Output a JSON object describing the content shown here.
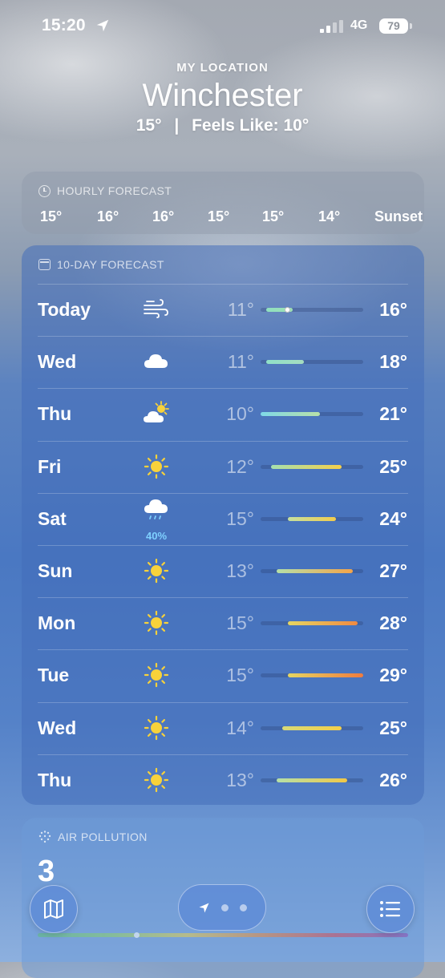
{
  "status_bar": {
    "time": "15:20",
    "network": "4G",
    "battery": "79"
  },
  "header": {
    "label": "MY LOCATION",
    "city": "Winchester",
    "current_temp": "15°",
    "separator": "|",
    "feels_like": "Feels Like: 10°"
  },
  "hourly": {
    "title": "HOURLY FORECAST",
    "items": [
      "15°",
      "16°",
      "16°",
      "15°",
      "15°",
      "14°",
      "Sunset"
    ]
  },
  "ten_day": {
    "title": "10-DAY FORECAST",
    "range_min": 10,
    "range_max": 29,
    "current_temp_value": 15,
    "rows": [
      {
        "day": "Today",
        "icon": "wind-icon",
        "low": "11°",
        "high": "16°",
        "low_value": 11,
        "high_value": 16,
        "precip": "",
        "colors": [
          "#8fe0c0",
          "#9ee0b4"
        ]
      },
      {
        "day": "Wed",
        "icon": "cloud-icon",
        "low": "11°",
        "high": "18°",
        "low_value": 11,
        "high_value": 18,
        "precip": "",
        "colors": [
          "#8fe0c8",
          "#a5dcc0"
        ]
      },
      {
        "day": "Thu",
        "icon": "partly-sunny-icon",
        "low": "10°",
        "high": "21°",
        "low_value": 10,
        "high_value": 21,
        "precip": "",
        "colors": [
          "#7fd9e8",
          "#b8e0a8"
        ]
      },
      {
        "day": "Fri",
        "icon": "sun-icon",
        "low": "12°",
        "high": "25°",
        "low_value": 12,
        "high_value": 25,
        "precip": "",
        "colors": [
          "#a5e0b0",
          "#f5cf4a"
        ]
      },
      {
        "day": "Sat",
        "icon": "rain-icon",
        "low": "15°",
        "high": "24°",
        "low_value": 15,
        "high_value": 24,
        "precip": "40%",
        "colors": [
          "#c5e0a0",
          "#f2cc4c"
        ]
      },
      {
        "day": "Sun",
        "icon": "sun-icon",
        "low": "13°",
        "high": "27°",
        "low_value": 13,
        "high_value": 27,
        "precip": "",
        "colors": [
          "#b5e0a8",
          "#f4a44a"
        ]
      },
      {
        "day": "Mon",
        "icon": "sun-icon",
        "low": "15°",
        "high": "28°",
        "low_value": 15,
        "high_value": 28,
        "precip": "",
        "colors": [
          "#e6d662",
          "#f08a42"
        ]
      },
      {
        "day": "Tue",
        "icon": "sun-icon",
        "low": "15°",
        "high": "29°",
        "low_value": 15,
        "high_value": 29,
        "precip": "",
        "colors": [
          "#e6d662",
          "#f07c3e"
        ]
      },
      {
        "day": "Wed",
        "icon": "sun-icon",
        "low": "14°",
        "high": "25°",
        "low_value": 14,
        "high_value": 25,
        "precip": "",
        "colors": [
          "#d8da78",
          "#f4cf48"
        ]
      },
      {
        "day": "Thu",
        "icon": "sun-icon",
        "low": "13°",
        "high": "26°",
        "low_value": 13,
        "high_value": 26,
        "precip": "",
        "colors": [
          "#b5e0a8",
          "#f2c846"
        ]
      }
    ]
  },
  "air_pollution": {
    "title": "AIR POLLUTION",
    "value": "3"
  },
  "bottom_bar": {
    "map_icon": "map-icon",
    "list_icon": "list-icon",
    "location_icon": "location-arrow-icon"
  }
}
